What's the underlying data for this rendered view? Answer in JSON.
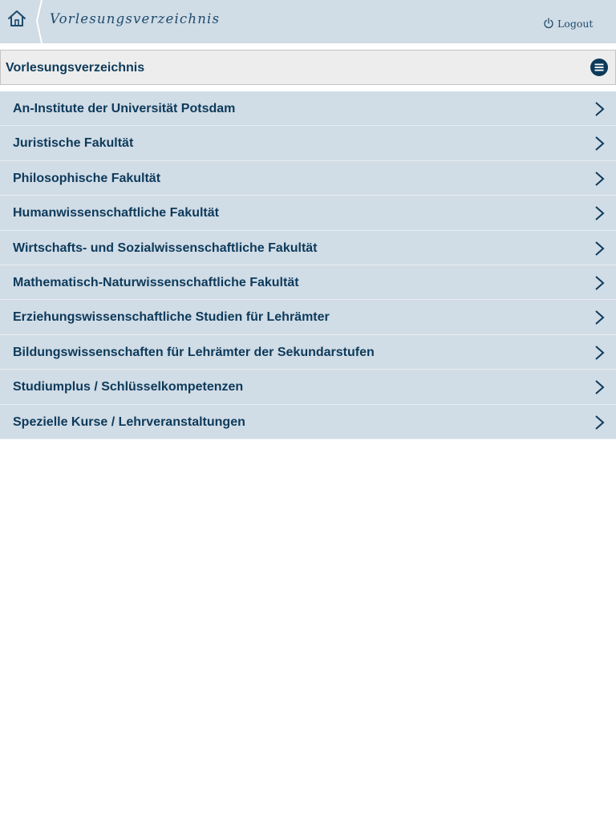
{
  "header": {
    "home_icon": "home-icon",
    "title": "Vorlesungsverzeichnis",
    "logout_icon": "power-icon",
    "logout_label": "Logout"
  },
  "section": {
    "title": "Vorlesungsverzeichnis",
    "menu_icon": "menu-icon"
  },
  "faculties": [
    {
      "label": "An-Institute der Universität Potsdam"
    },
    {
      "label": "Juristische Fakultät"
    },
    {
      "label": "Philosophische Fakultät"
    },
    {
      "label": "Humanwissenschaftliche Fakultät"
    },
    {
      "label": "Wirtschafts- und Sozialwissenschaftliche Fakultät"
    },
    {
      "label": "Mathematisch-Naturwissenschaftliche Fakultät"
    },
    {
      "label": "Erziehungswissenschaftliche Studien für Lehrämter"
    },
    {
      "label": "Bildungswissenschaften für Lehrämter der Sekundarstufen"
    },
    {
      "label": "Studiumplus / Schlüsselkompetenzen"
    },
    {
      "label": "Spezielle Kurse / Lehrveranstaltungen"
    }
  ],
  "colors": {
    "header_bg": "#d0dce6",
    "text_primary": "#0d3a5a",
    "section_bg": "#ededed",
    "list_bg": "#d0dce6"
  }
}
